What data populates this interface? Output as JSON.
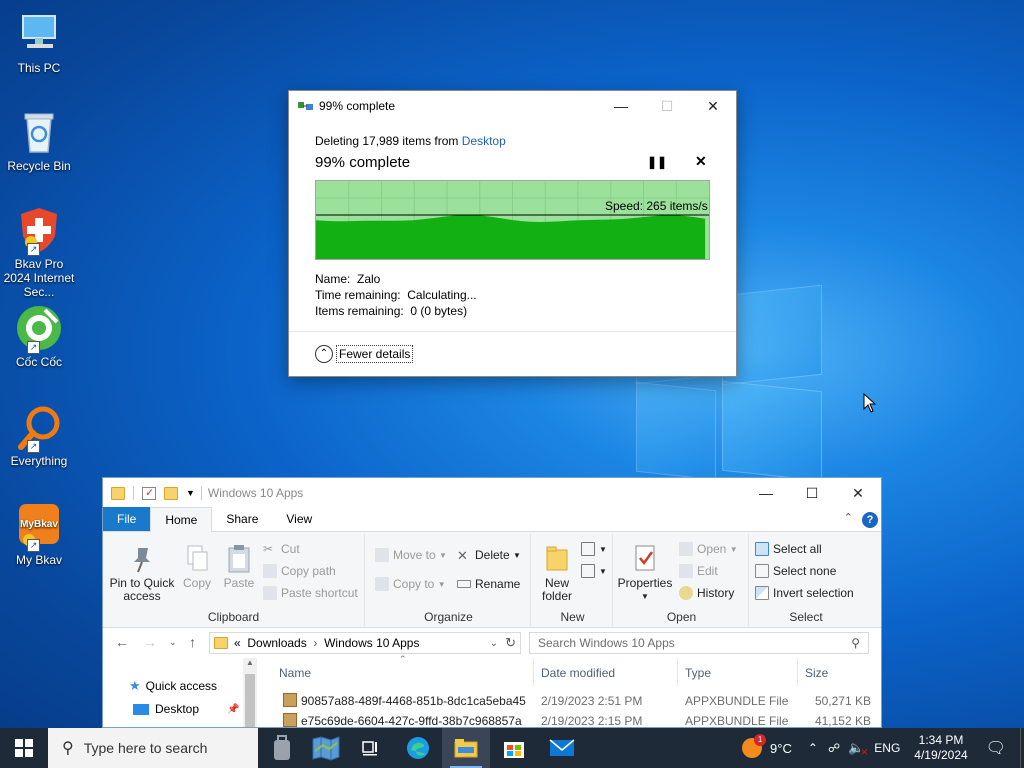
{
  "desktop": {
    "icons": [
      {
        "label": "This PC"
      },
      {
        "label": "Recycle Bin"
      },
      {
        "label": "Bkav Pro 2024 Internet Sec..."
      },
      {
        "label": "Cốc Cốc"
      },
      {
        "label": "Everything"
      },
      {
        "label": "My Bkav"
      }
    ]
  },
  "progress_dialog": {
    "title": "99% complete",
    "operation_prefix": "Deleting 17,989 items from",
    "operation_location": "Desktop",
    "headline": "99% complete",
    "pause_icon": "pause-icon",
    "speed": "Speed: 265 items/s",
    "percent_complete": 99,
    "name_label": "Name:",
    "name_value": "Zalo",
    "time_label": "Time remaining:",
    "time_value": "Calculating...",
    "items_label": "Items remaining:",
    "items_value": "0 (0 bytes)",
    "fewer_details": "Fewer details"
  },
  "explorer": {
    "title": "Windows 10 Apps",
    "tabs": [
      "File",
      "Home",
      "Share",
      "View"
    ],
    "active_tab": "Home",
    "ribbon": {
      "clipboard": {
        "label": "Clipboard",
        "pin": "Pin to Quick access",
        "copy": "Copy",
        "paste": "Paste",
        "cut": "Cut",
        "copy_path": "Copy path",
        "paste_shortcut": "Paste shortcut"
      },
      "organize": {
        "label": "Organize",
        "move_to": "Move to",
        "copy_to": "Copy to",
        "delete": "Delete",
        "rename": "Rename"
      },
      "new": {
        "label": "New",
        "new_folder": "New folder"
      },
      "open": {
        "label": "Open",
        "properties": "Properties",
        "open": "Open",
        "edit": "Edit",
        "history": "History"
      },
      "select": {
        "label": "Select",
        "select_all": "Select all",
        "select_none": "Select none",
        "invert": "Invert selection"
      }
    },
    "address": {
      "prefix": "«",
      "crumbs": [
        "Downloads",
        "Windows 10 Apps"
      ]
    },
    "search_placeholder": "Search Windows 10 Apps",
    "nav": {
      "quick_access": "Quick access",
      "desktop": "Desktop"
    },
    "columns": {
      "name": "Name",
      "date": "Date modified",
      "type": "Type",
      "size": "Size"
    },
    "files": [
      {
        "name": "90857a88-489f-4468-851b-8dc1ca5eba45",
        "date": "2/19/2023 2:51 PM",
        "type": "APPXBUNDLE File",
        "size": "50,271 KB"
      },
      {
        "name": "e75c69de-6604-427c-9ffd-38b7c968857a",
        "date": "2/19/2023 2:15 PM",
        "type": "APPXBUNDLE File",
        "size": "41,152 KB"
      }
    ]
  },
  "taskbar": {
    "search_placeholder": "Type here to search",
    "weather_temp": "9°C",
    "weather_badge": "1",
    "language": "ENG",
    "time": "1:34 PM",
    "date": "4/19/2024"
  },
  "colors": {
    "graph_fill": "#12b012",
    "graph_background": "#9be09b",
    "accent_blue": "#1979ca",
    "taskbar": "#1e2a38"
  }
}
